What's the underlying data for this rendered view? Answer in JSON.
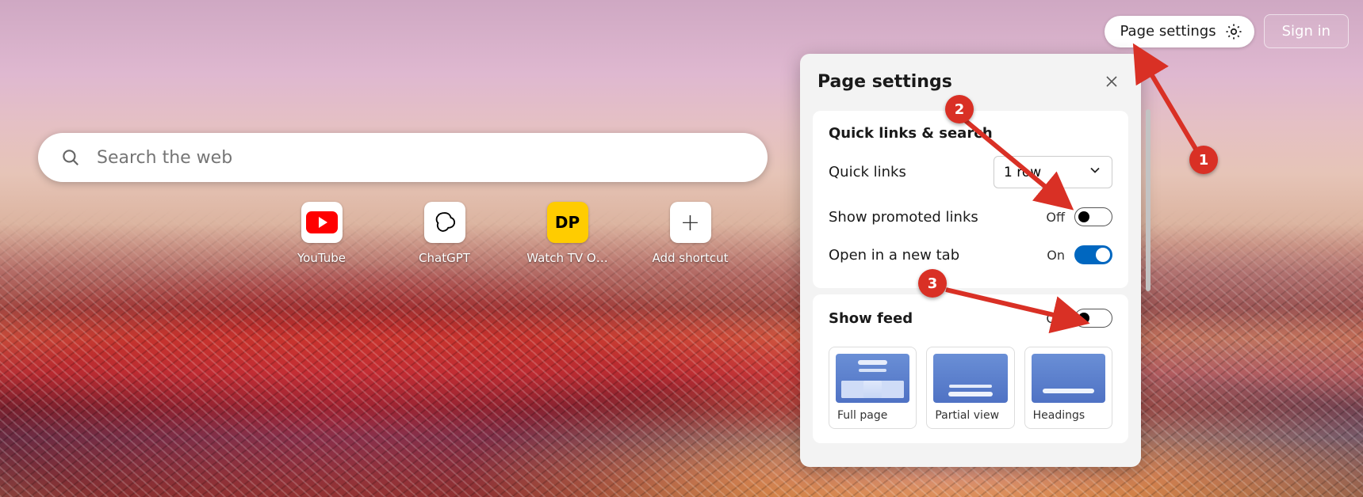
{
  "topbar": {
    "page_settings_label": "Page settings",
    "signin_label": "Sign in"
  },
  "search": {
    "placeholder": "Search the web"
  },
  "shortcuts": [
    {
      "label": "YouTube",
      "icon": "youtube-icon"
    },
    {
      "label": "ChatGPT",
      "icon": "chatgpt-icon"
    },
    {
      "label": "Watch TV O…",
      "icon": "dp-icon",
      "glyph": "DP"
    },
    {
      "label": "Add shortcut",
      "icon": "plus-icon",
      "glyph": "+"
    }
  ],
  "panel": {
    "title": "Page settings",
    "section1_title": "Quick links & search",
    "quick_links_label": "Quick links",
    "quick_links_value": "1 row",
    "show_promoted_label": "Show promoted links",
    "show_promoted_state_text": "Off",
    "show_promoted_state": "off",
    "open_new_tab_label": "Open in a new tab",
    "open_new_tab_state_text": "On",
    "open_new_tab_state": "on",
    "show_feed_label": "Show feed",
    "show_feed_state_text": "Off",
    "show_feed_state": "off",
    "layouts": [
      {
        "label": "Full page"
      },
      {
        "label": "Partial view"
      },
      {
        "label": "Headings"
      }
    ]
  },
  "annotations": {
    "callouts": [
      "1",
      "2",
      "3"
    ]
  }
}
